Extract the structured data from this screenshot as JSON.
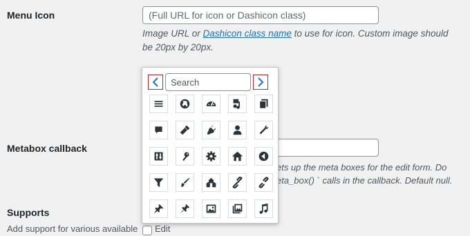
{
  "menu_icon": {
    "label": "Menu Icon",
    "input_placeholder": "(Full URL for icon or Dashicon class)",
    "desc_part1": "Image URL or ",
    "desc_link": "Dashicon class name",
    "desc_part2": " to use for icon. Custom image should be 20px by 20px."
  },
  "metabox": {
    "label": "Metabox callback",
    "desc_line1_visible": "ets up the meta boxes for the edit form. Do",
    "desc_line2_visible": "eta_box() ` calls in the callback. Default null."
  },
  "supports": {
    "label": "Supports",
    "partial_text": "Add support for various available",
    "checkbox_label_partial": "Edit"
  },
  "icon_picker": {
    "search_placeholder": "Search",
    "prev_icon": "chevron-left-icon",
    "next_icon": "chevron-right-icon",
    "accent_color": "#2271b1",
    "nav_border_color": "#b32d2e",
    "icons": [
      "menu-icon",
      "admin-site-icon",
      "dashboard-icon",
      "admin-media-icon",
      "admin-page-icon",
      "admin-comments-icon",
      "admin-appearance-icon",
      "admin-plugins-icon",
      "admin-users-icon",
      "admin-tools-icon",
      "admin-settings-icon",
      "admin-network-icon",
      "admin-generic-icon",
      "admin-home-icon",
      "admin-collapse-icon",
      "filter-icon",
      "admin-customizer-icon",
      "admin-multisite-icon",
      "admin-links-icon",
      "editor-unlink-icon",
      "admin-post-icon",
      "pin-icon",
      "format-image-icon",
      "format-gallery-icon",
      "format-audio-icon"
    ]
  }
}
